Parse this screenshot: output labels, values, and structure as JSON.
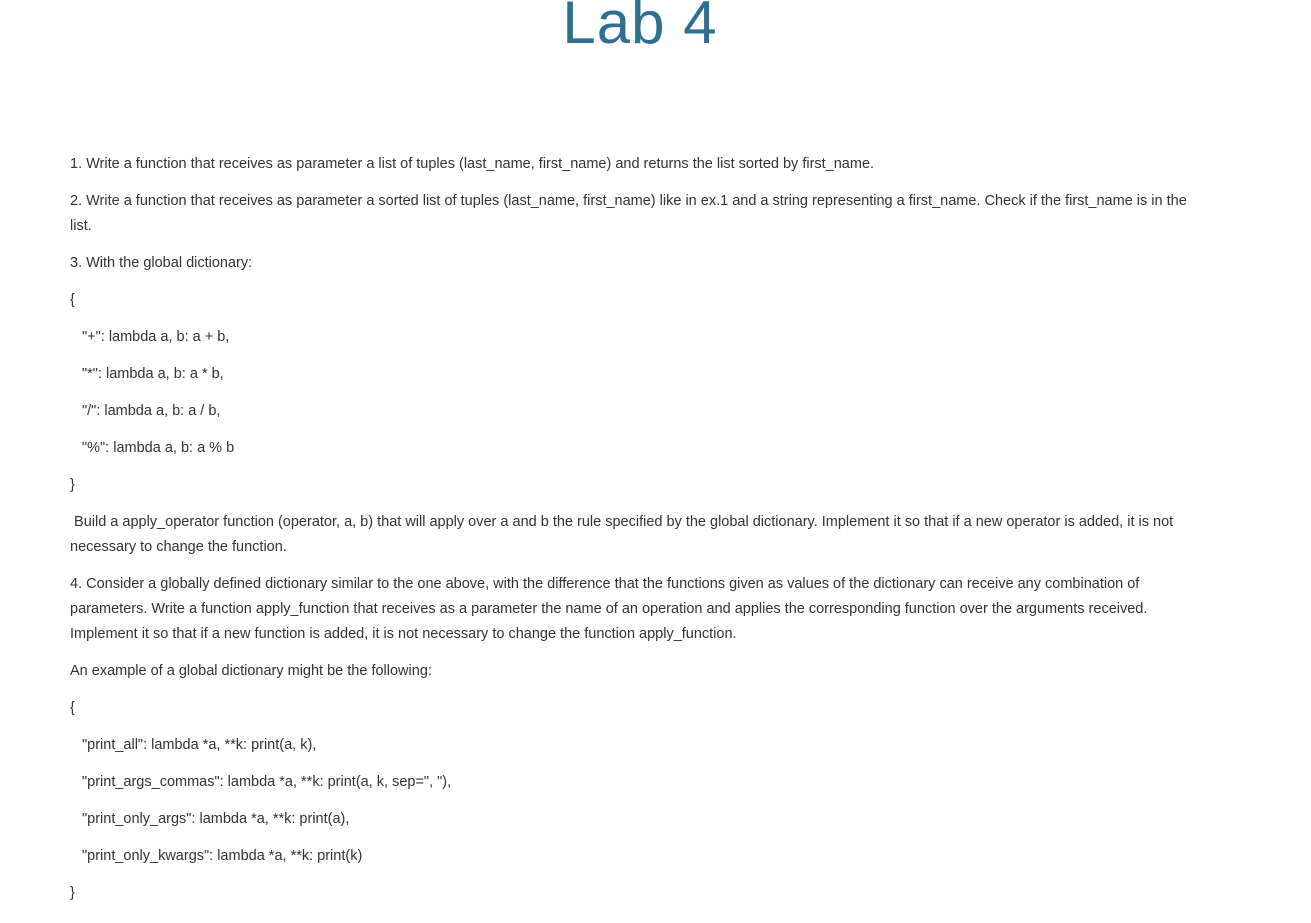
{
  "page": {
    "title": "Lab 4"
  },
  "content": {
    "paragraphs": [
      "1. Write a function that receives as parameter a list of tuples (last_name, first_name) and returns the list sorted by first_name.",
      "2. Write a function that receives as parameter a sorted list of tuples (last_name, first_name) like in ex.1 and a string representing a first_name. Check if the first_name is in the list.",
      "3. With the global dictionary:",
      "{",
      "\"+\": lambda a, b: a + b,",
      "\"*\": lambda a, b: a * b,",
      "\"/\": lambda a, b: a / b,",
      "\"%\": lambda a, b: a % b",
      "}",
      " Build a apply_operator function (operator, a, b) that will apply over a and b the rule specified by the global dictionary. Implement it so that if a new operator is added, it is not necessary to change the function.",
      "4. Consider a globally defined dictionary similar to the one above, with the difference that the functions given as values of the dictionary can receive any combination of parameters. Write a function apply_function that receives as a parameter the name of an operation and applies the corresponding function over the arguments received. Implement it so that if a new function is added, it is not necessary to change the function apply_function.",
      "An example of a global dictionary might be the following:",
      "{",
      "\"print_all\": lambda *a, **k: print(a, k),",
      "\"print_args_commas\": lambda *a, **k: print(a, k, sep=\", \"),",
      "\"print_only_args\": lambda *a, **k: print(a),",
      "\"print_only_kwargs\": lambda *a, **k: print(k)",
      "}"
    ]
  }
}
